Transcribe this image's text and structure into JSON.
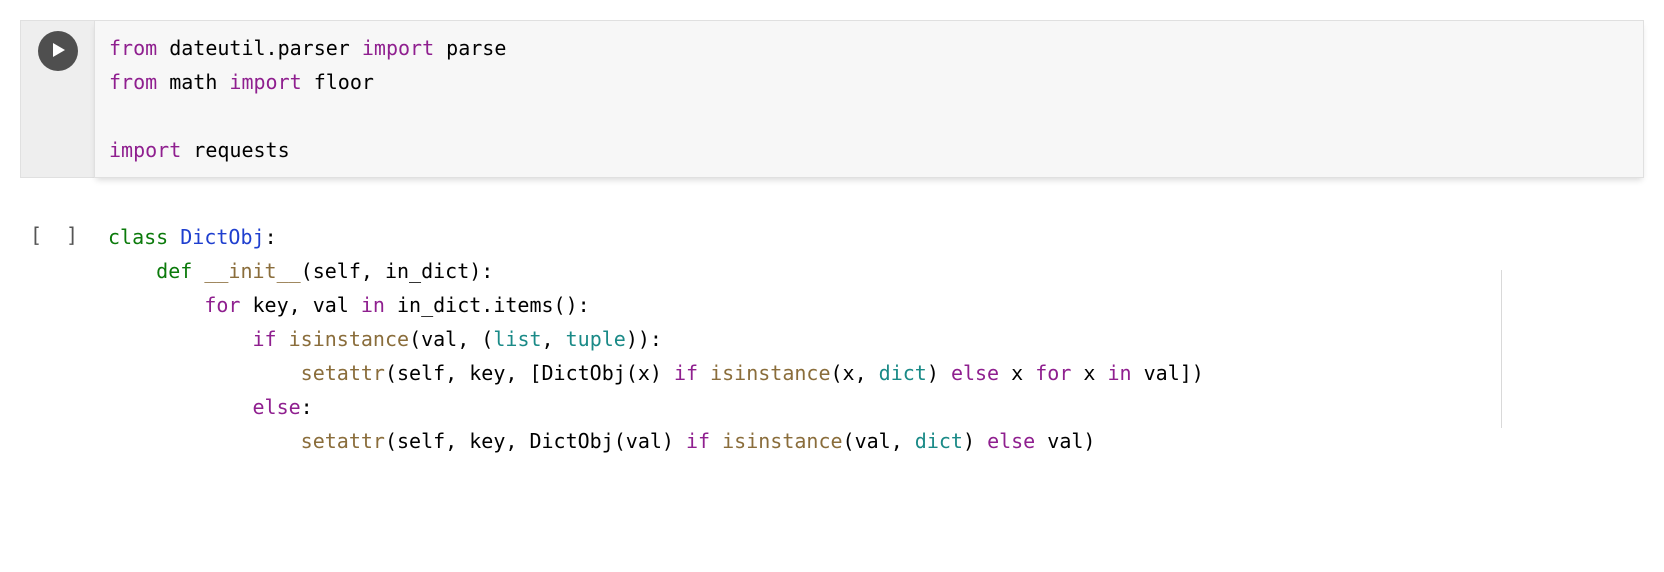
{
  "cells": [
    {
      "status": "active",
      "code_html": "<span class=\"k\">from</span> dateutil.parser <span class=\"k\">import</span> parse\n<span class=\"k\">from</span> math <span class=\"k\">import</span> floor\n\n<span class=\"k\">import</span> requests"
    },
    {
      "status": "idle",
      "bracket": "[ ]",
      "code_html": "<span class=\"kd\">class</span> <span class=\"fn\">DictObj</span>:\n    <span class=\"kd\">def</span> <span class=\"mg\">__init__</span>(self, in_dict):\n        <span class=\"k\">for</span> key, val <span class=\"k\">in</span> in_dict.items():\n            <span class=\"k\">if</span> <span class=\"mg\">isinstance</span>(val, (<span class=\"bn\">list</span>, <span class=\"bn\">tuple</span>)):\n                <span class=\"mg\">setattr</span>(self, key, [DictObj(x) <span class=\"k\">if</span> <span class=\"mg\">isinstance</span>(x, <span class=\"bn\">dict</span>) <span class=\"k\">else</span> x <span class=\"k\">for</span> x <span class=\"k\">in</span> val])\n            <span class=\"k\">else</span>:\n                <span class=\"mg\">setattr</span>(self, key, DictObj(val) <span class=\"k\">if</span> <span class=\"mg\">isinstance</span>(val, <span class=\"bn\">dict</span>) <span class=\"k\">else</span> val)"
    }
  ]
}
